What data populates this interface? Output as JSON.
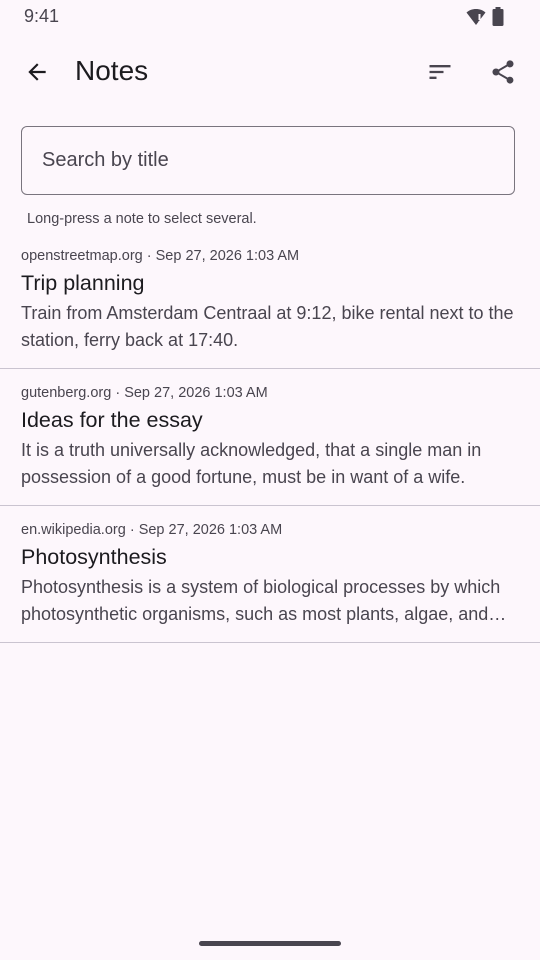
{
  "status_bar": {
    "time": "9:41",
    "icons": [
      "wifi-alert-icon",
      "battery-icon"
    ]
  },
  "app_bar": {
    "title": "Notes",
    "back_icon": "arrow-back-icon",
    "sort_icon": "sort-icon",
    "share_icon": "share-icon"
  },
  "search": {
    "placeholder": "Search by title",
    "value": ""
  },
  "hint": "Long-press a note to select several.",
  "notes": [
    {
      "source": "openstreetmap.org",
      "separator": " · ",
      "date": "Sep 27, 2026 1:03 AM",
      "title": "Trip planning",
      "body": "Train from Amsterdam Centraal at 9:12, bike rental next to the station, ferry back at 17:40."
    },
    {
      "source": "gutenberg.org",
      "separator": " · ",
      "date": "Sep 27, 2026 1:03 AM",
      "title": "Ideas for the essay",
      "body": "It is a truth universally acknowledged, that a single man in possession of a good fortune, must be in want of a wife."
    },
    {
      "source": "en.wikipedia.org",
      "separator": " · ",
      "date": "Sep 27, 2026 1:03 AM",
      "title": "Photosynthesis",
      "body": "Photosynthesis is a system of biological processes by which photosynthetic organisms, such as most plants, algae, and cyanobacteria, convert light energy into chemical energy."
    }
  ],
  "colors": {
    "background": "#fdf7fc",
    "on_surface": "#1c1b1f",
    "on_surface_variant": "#49454f",
    "outline": "#79747e",
    "divider": "#cac4d0"
  }
}
